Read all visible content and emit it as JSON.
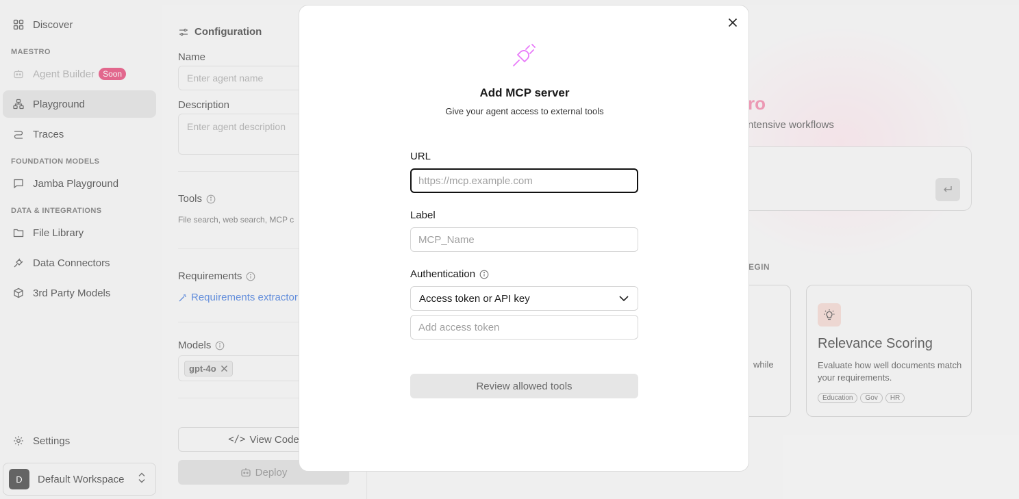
{
  "sidebar": {
    "discover": "Discover",
    "section_maestro": "MAESTRO",
    "agent_builder": "Agent Builder",
    "soon_badge": "Soon",
    "playground": "Playground",
    "traces": "Traces",
    "section_foundation": "FOUNDATION MODELS",
    "jamba_playground": "Jamba Playground",
    "section_data": "DATA & INTEGRATIONS",
    "file_library": "File Library",
    "data_connectors": "Data Connectors",
    "third_party_models": "3rd Party Models",
    "settings": "Settings",
    "workspace_initial": "D",
    "workspace_name": "Default Workspace"
  },
  "config": {
    "title": "Configuration",
    "name_label": "Name",
    "name_placeholder": "Enter agent name",
    "description_label": "Description",
    "description_placeholder": "Enter agent description",
    "tools_label": "Tools",
    "tools_desc": "File search, web search, MCP c",
    "requirements_label": "Requirements",
    "requirements_link": "Requirements extractor",
    "models_label": "Models",
    "model_chip": "gpt-4o",
    "view_code": "View Code",
    "deploy": "Deploy"
  },
  "background": {
    "hero_tail": "ro",
    "hero_sub": "ntensive workflows",
    "begin_label": "EGIN",
    "card1_desc": "while",
    "card2_title": "Relevance Scoring",
    "card2_desc": "Evaluate how well documents match your requirements.",
    "card2_tags": [
      "Education",
      "Gov",
      "HR"
    ]
  },
  "modal": {
    "title": "Add MCP server",
    "subtitle": "Give your agent access to external tools",
    "url_label": "URL",
    "url_placeholder": "https://mcp.example.com",
    "label_label": "Label",
    "label_placeholder": "MCP_Name",
    "auth_label": "Authentication",
    "auth_selected": "Access token or API key",
    "token_placeholder": "Add access token",
    "review_button": "Review allowed tools"
  },
  "colors": {
    "accent_pink": "#e879f9",
    "soon_badge": "#e0245e",
    "link_blue": "#1d5fd6"
  },
  "icons": {
    "close": "close-icon",
    "plug": "plug-icon",
    "chevron": "chevron-down-icon",
    "info": "info-icon"
  }
}
